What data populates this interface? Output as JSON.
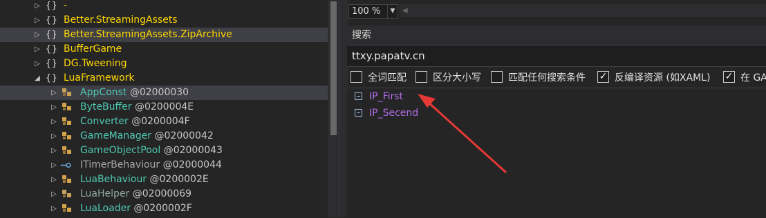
{
  "tree": {
    "rows": [
      {
        "label": "-",
        "kind": "namespace",
        "expanded": false
      },
      {
        "label": "Better.StreamingAssets",
        "kind": "namespace",
        "expanded": false
      },
      {
        "label": "Better.StreamingAssets.ZipArchive",
        "kind": "namespace",
        "expanded": false,
        "selected": true
      },
      {
        "label": "BufferGame",
        "kind": "namespace",
        "expanded": false
      },
      {
        "label": "DG.Tweening",
        "kind": "namespace",
        "expanded": false
      },
      {
        "label": "LuaFramework",
        "kind": "namespace",
        "expanded": true
      },
      {
        "label": "AppConst",
        "token": "@02000030",
        "kind": "static-class",
        "selected": true
      },
      {
        "label": "ByteBuffer",
        "token": "@0200004E",
        "kind": "class"
      },
      {
        "label": "Converter",
        "token": "@0200004F",
        "kind": "class"
      },
      {
        "label": "GameManager",
        "token": "@02000042",
        "kind": "class"
      },
      {
        "label": "GameObjectPool",
        "token": "@02000043",
        "kind": "class"
      },
      {
        "label": "ITimerBehaviour",
        "token": "@02000044",
        "kind": "interface"
      },
      {
        "label": "LuaBehaviour",
        "token": "@0200002E",
        "kind": "class"
      },
      {
        "label": "LuaHelper",
        "token": "@02000069",
        "kind": "static-class"
      },
      {
        "label": "LuaLoader",
        "token": "@0200002F",
        "kind": "class"
      }
    ]
  },
  "toolbar": {
    "zoom_value": "100 %"
  },
  "search": {
    "title": "搜索",
    "query": "ttxy.papatv.cn",
    "options": [
      {
        "label": "全词匹配",
        "checked": false
      },
      {
        "label": "区分大小写",
        "checked": false
      },
      {
        "label": "匹配任何搜索条件",
        "checked": false
      },
      {
        "label": "反编译资源 (如XAML)",
        "checked": true
      },
      {
        "label": "在 GA",
        "checked": true
      }
    ],
    "results": [
      {
        "label": "IP_First"
      },
      {
        "label": "IP_Secend"
      }
    ]
  },
  "colors": {
    "namespace": "#ffd700",
    "class": "#4ec9b0",
    "field": "#b16ee8",
    "annotation_arrow": "#e53935"
  },
  "icons": {
    "namespace": "namespace-braces-icon",
    "class": "class-icon",
    "interface": "interface-icon",
    "field": "field-icon"
  }
}
